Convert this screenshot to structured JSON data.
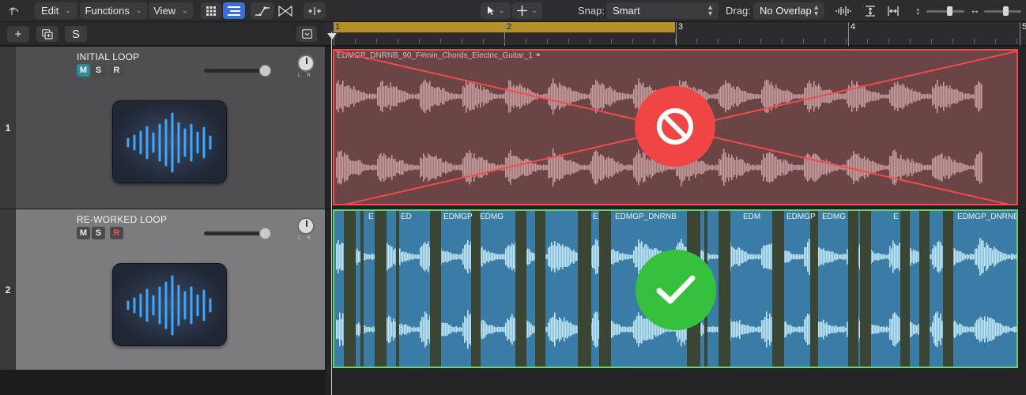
{
  "toolbar": {
    "edit_label": "Edit",
    "functions_label": "Functions",
    "view_label": "View",
    "snap_label": "Snap:",
    "snap_value": "Smart",
    "drag_label": "Drag:",
    "drag_value": "No Overlap"
  },
  "headers_toolbar": {
    "add_label": "+",
    "solo_label": "S"
  },
  "ruler": {
    "bars": [
      "1",
      "2",
      "3",
      "4",
      "5"
    ]
  },
  "tracks": [
    {
      "number": "1",
      "name": "INITIAL LOOP",
      "mute": "M",
      "solo": "S",
      "record": "R",
      "pan_marks": "LR",
      "region_name": "EDMGP_DNRNB_90_F#min_Chords_Electric_Guitar_1"
    },
    {
      "number": "2",
      "name": "RE-WORKED LOOP",
      "mute": "M",
      "solo": "S",
      "record": "R",
      "pan_marks": "LR",
      "segment_names": [
        "E",
        "ED",
        "EDMGP",
        "EDMG",
        "E",
        "EDMGP_DNRNB",
        "EDM",
        "EDMGP",
        "EDMG",
        "E",
        "EDMGP_DNRNB"
      ]
    }
  ],
  "colors": {
    "track1_region": "#6b4446",
    "track1_outline": "#f24b4b",
    "track2_region": "#3b7ca6",
    "track2_outline": "#6ad46a",
    "cycle": "#b5912a",
    "no_badge": "#f04545",
    "ok_badge": "#35c13d"
  },
  "icons": {
    "bad_badge": "prohibited-icon",
    "good_badge": "checkmark-icon",
    "track_icon": "waveform-icon"
  }
}
